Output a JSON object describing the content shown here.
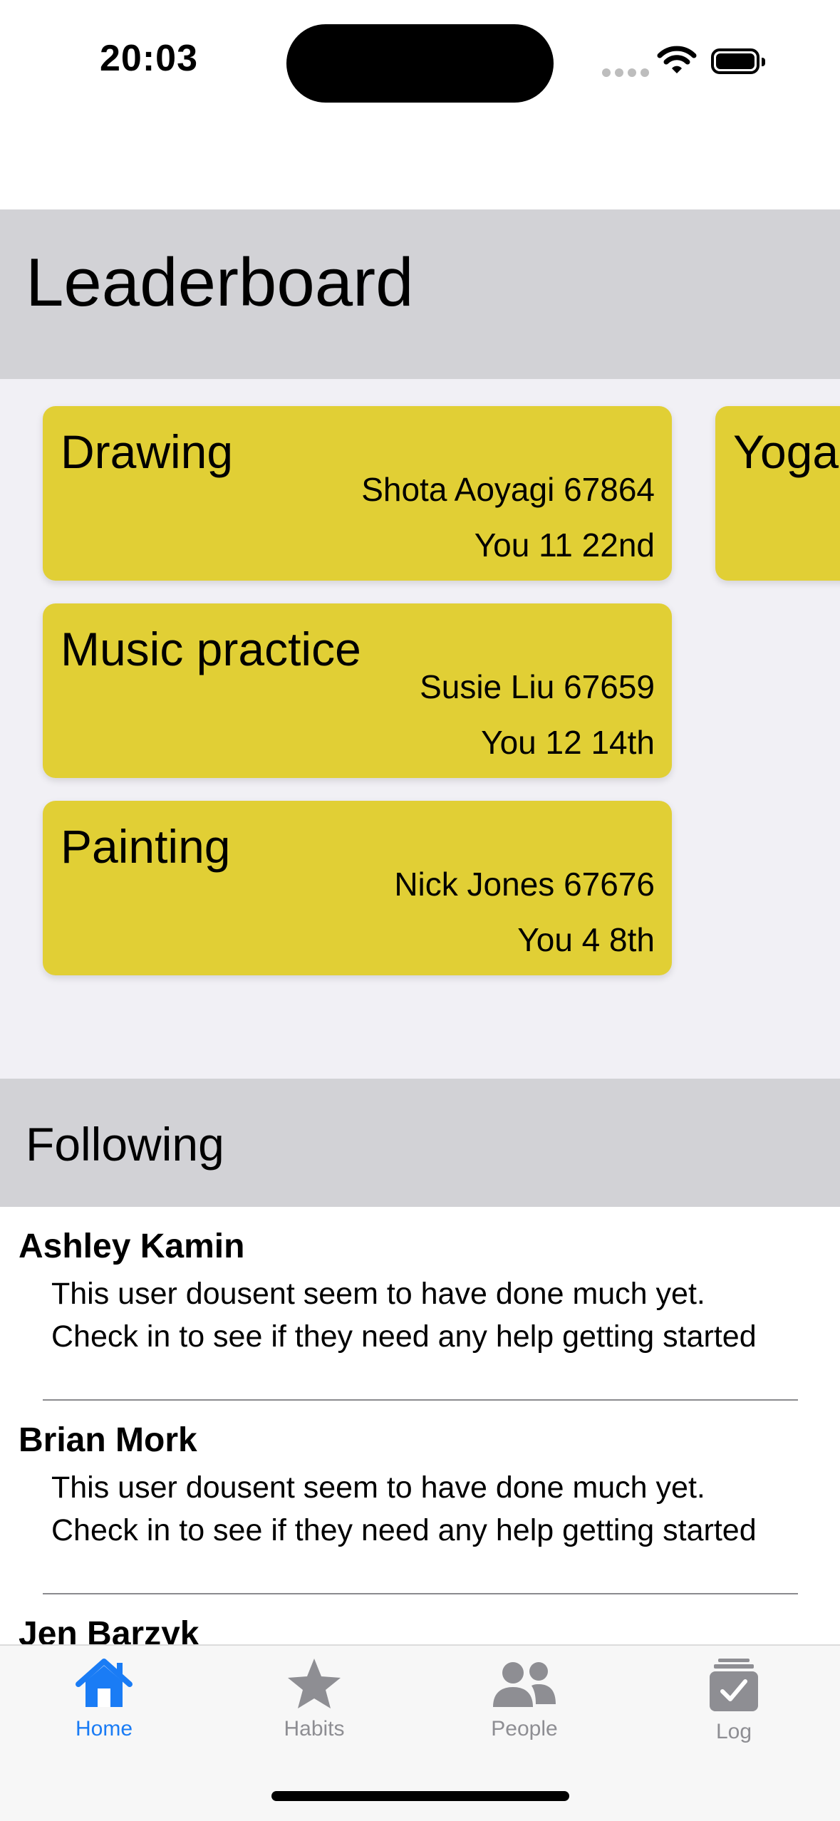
{
  "status_bar": {
    "time": "20:03"
  },
  "leaderboard": {
    "title": "Leaderboard",
    "cards": [
      {
        "title": "Drawing",
        "leader": "Shota Aoyagi 67864",
        "you": "You 11 22nd"
      },
      {
        "title": "Music practice",
        "leader": "Susie Liu 67659",
        "you": "You 12 14th"
      },
      {
        "title": "Painting",
        "leader": "Nick Jones 67676",
        "you": "You 4 8th"
      },
      {
        "title": "Yoga",
        "leader": "",
        "you": ""
      }
    ],
    "card_color": "#e1cf35"
  },
  "following": {
    "title": "Following",
    "items": [
      {
        "name": "Ashley Kamin",
        "message_line1": "This user dousent seem to have done much yet.",
        "message_line2": "Check in to see if they need any help getting started"
      },
      {
        "name": "Brian Mork",
        "message_line1": "This user dousent seem to have done much yet.",
        "message_line2": "Check in to see if they need any help getting started"
      },
      {
        "name": "Jen Barzyk"
      }
    ]
  },
  "tab_bar": {
    "tabs": [
      {
        "label": "Home",
        "icon": "house-icon",
        "active": true
      },
      {
        "label": "Habits",
        "icon": "star-icon",
        "active": false
      },
      {
        "label": "People",
        "icon": "people-icon",
        "active": false
      },
      {
        "label": "Log",
        "icon": "log-checkmark-icon",
        "active": false
      }
    ],
    "accent_color": "#1a7cf5",
    "inactive_color": "#8e8e93"
  }
}
